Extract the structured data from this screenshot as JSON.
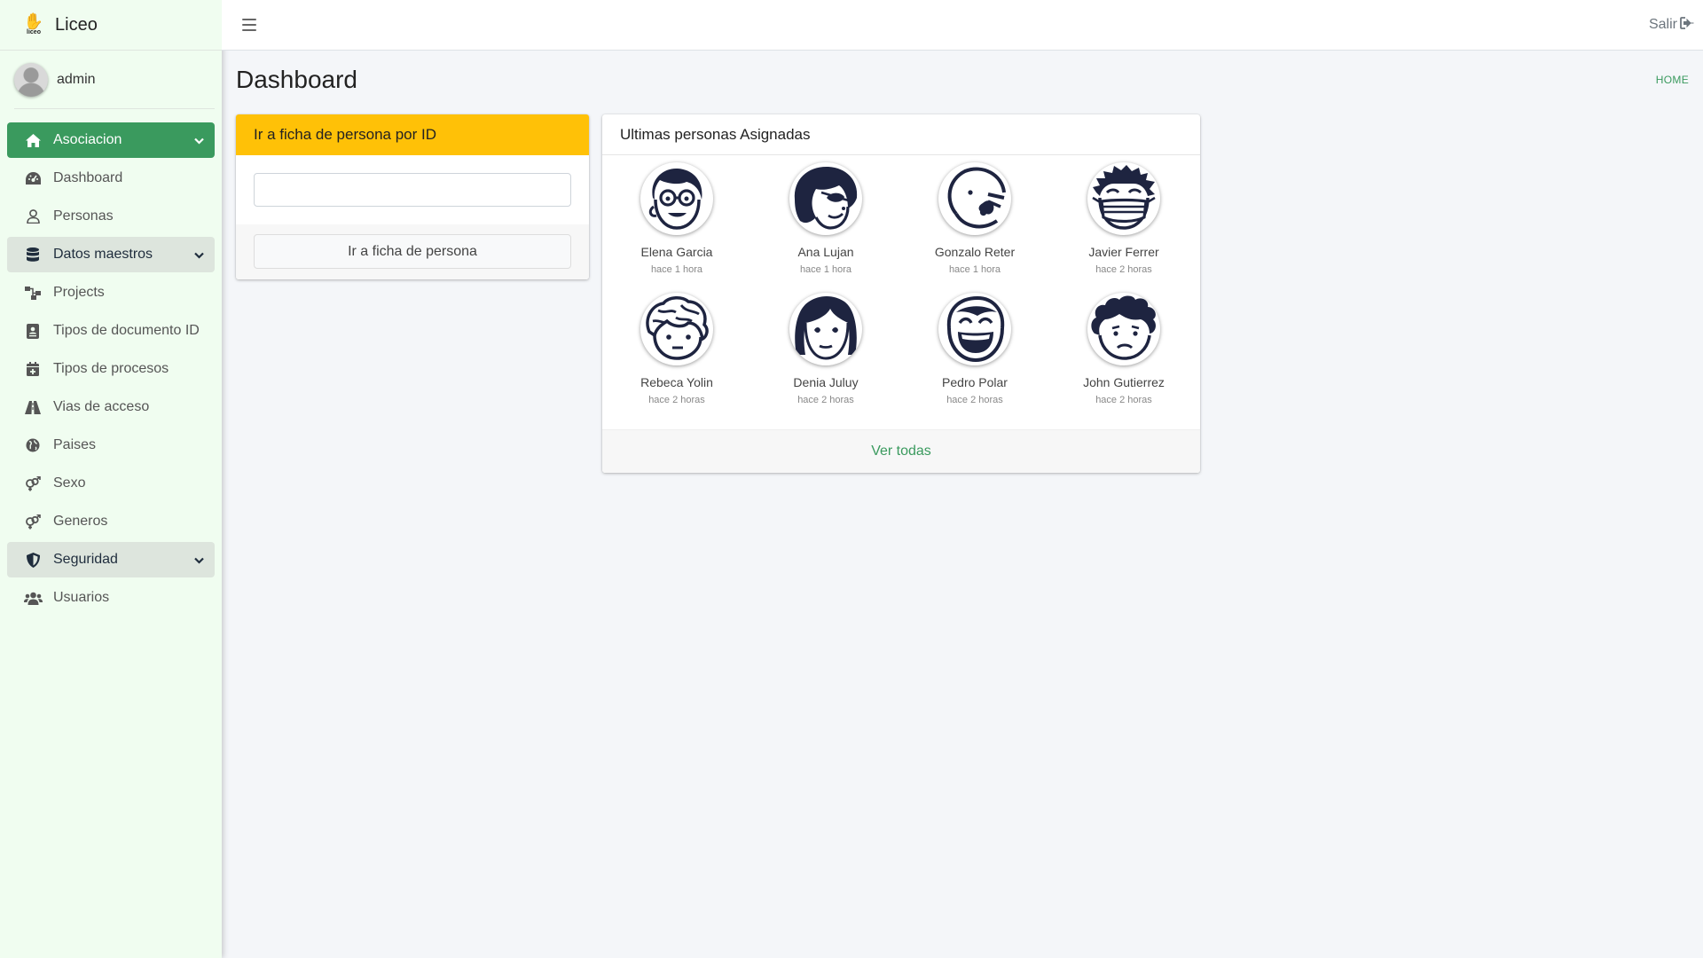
{
  "app": {
    "brand": "Liceo",
    "logo_text": "liceo"
  },
  "user": {
    "name": "admin"
  },
  "sidebar": {
    "items": [
      {
        "label": "Asociacion",
        "icon": "home-icon",
        "type": "header-active"
      },
      {
        "label": "Dashboard",
        "icon": "gauge-icon",
        "type": "item"
      },
      {
        "label": "Personas",
        "icon": "user-icon",
        "type": "item"
      },
      {
        "label": "Datos maestros",
        "icon": "database-icon",
        "type": "header"
      },
      {
        "label": "Projects",
        "icon": "sitemap-icon",
        "type": "item"
      },
      {
        "label": "Tipos de documento ID",
        "icon": "id-card-icon",
        "type": "item"
      },
      {
        "label": "Tipos de procesos",
        "icon": "calendar-plus-icon",
        "type": "item"
      },
      {
        "label": "Vias de acceso",
        "icon": "road-icon",
        "type": "item"
      },
      {
        "label": "Paises",
        "icon": "globe-icon",
        "type": "item"
      },
      {
        "label": "Sexo",
        "icon": "venus-mars-icon",
        "type": "item"
      },
      {
        "label": "Generos",
        "icon": "venus-mars-icon",
        "type": "item"
      },
      {
        "label": "Seguridad",
        "icon": "shield-icon",
        "type": "header"
      },
      {
        "label": "Usuarios",
        "icon": "users-icon",
        "type": "item"
      }
    ]
  },
  "topbar": {
    "logout_label": "Salir"
  },
  "header": {
    "title": "Dashboard",
    "breadcrumb": "HOME"
  },
  "search_card": {
    "title": "Ir a ficha de persona por ID",
    "input_value": "",
    "button_label": "Ir a ficha de persona"
  },
  "people_card": {
    "title": "Ultimas personas Asignadas",
    "footer_link": "Ver todas",
    "people": [
      {
        "name": "Elena Garcia",
        "time": "hace 1 hora",
        "avatar": "glasses-face"
      },
      {
        "name": "Ana Lujan",
        "time": "hace 1 hora",
        "avatar": "eyepatch-face"
      },
      {
        "name": "Gonzalo Reter",
        "time": "hace 1 hora",
        "avatar": "bald-mustache-face"
      },
      {
        "name": "Javier Ferrer",
        "time": "hace 2 horas",
        "avatar": "mask-face"
      },
      {
        "name": "Rebeca Yolin",
        "time": "hace 2 horas",
        "avatar": "messy-hair-face"
      },
      {
        "name": "Denia Juluy",
        "time": "hace 2 horas",
        "avatar": "long-hair-face"
      },
      {
        "name": "Pedro Polar",
        "time": "hace 2 horas",
        "avatar": "laughing-face"
      },
      {
        "name": "John Gutierrez",
        "time": "hace 2 horas",
        "avatar": "curly-sad-face"
      }
    ]
  },
  "colors": {
    "accent": "#3a9a5e",
    "sidebar_bg": "#f0fdf0",
    "warning": "#ffc107",
    "avatar_ink": "#1e2440"
  }
}
